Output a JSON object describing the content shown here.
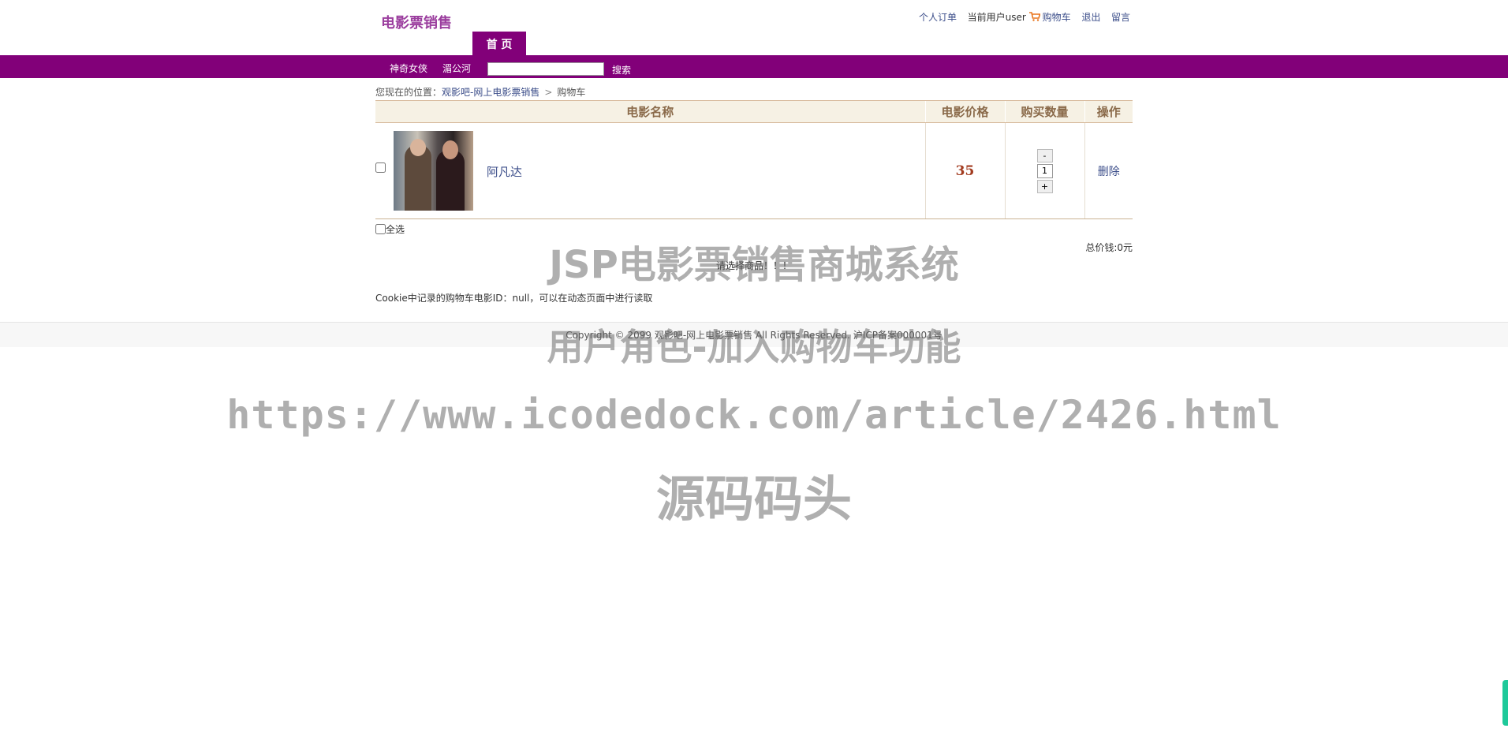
{
  "header": {
    "logo": "电影票销售",
    "links": {
      "orders": "个人订单",
      "current_user": "当前用户user",
      "cart": "购物车",
      "logout": "退出",
      "message": "留言"
    }
  },
  "nav": {
    "home_tab": "首 页",
    "movies": [
      "神奇女侠",
      "湄公河"
    ],
    "search_button": "搜索",
    "search_value": ""
  },
  "breadcrumb": {
    "prefix": "您现在的位置：",
    "site": "观影吧-网上电影票销售",
    "separator": ">",
    "current": "购物车"
  },
  "cart": {
    "columns": [
      "电影名称",
      "电影价格",
      "购买数量",
      "操作"
    ],
    "items": [
      {
        "name": "阿凡达",
        "price": "35",
        "quantity": "1",
        "delete_label": "删除"
      }
    ],
    "qty_minus": "-",
    "qty_plus": "+",
    "select_all": "全选",
    "total": "总价钱:0元",
    "prompt": "请选择商品！！！",
    "cookie_note": "Cookie中记录的购物车电影ID：null，可以在动态页面中进行读取"
  },
  "footer": {
    "copyright": "Copyright © 2099 观影吧-网上电影票销售 All Rights Reserved. 沪ICP备案000001号"
  },
  "watermark": {
    "line1": "JSP电影票销售商城系统",
    "line2": "用户角色-加入购物车功能",
    "line3": "https://www.icodedock.com/article/2426.html",
    "line4": "源码码头"
  },
  "colors": {
    "brand_purple": "#820079",
    "logo": "#9b3e9e",
    "link": "#3c4e8a",
    "price": "#a23b1f",
    "table_header_bg": "#f6f1e4"
  }
}
